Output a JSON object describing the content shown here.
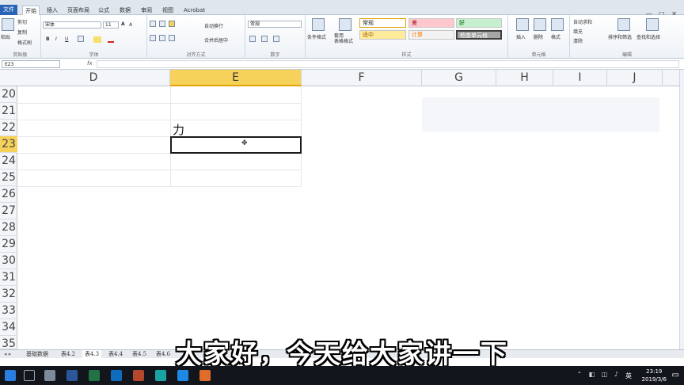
{
  "ribbon_tabs": [
    "文件",
    "开始",
    "插入",
    "页面布局",
    "公式",
    "数据",
    "审阅",
    "视图",
    "Acrobat"
  ],
  "window_controls": "— □ ✕",
  "clipboard": {
    "paste": "粘贴",
    "cut": "剪切",
    "copy": "复制",
    "painter": "格式刷",
    "label": "剪贴板"
  },
  "font": {
    "name": "宋体",
    "size": "11",
    "bold": "B",
    "italic": "I",
    "underline": "U",
    "grow": "A",
    "shrink": "A",
    "label": "字体"
  },
  "alignment": {
    "wrap": "自动换行",
    "merge": "合并后居中",
    "label": "对齐方式"
  },
  "number": {
    "format": "常规",
    "label": "数字"
  },
  "styles": {
    "conditional": "条件格式",
    "table": "套用\n表格格式",
    "normal": "常规",
    "bad": "差",
    "good": "好",
    "neutral": "适中",
    "calc": "计算",
    "check": "检查单元格",
    "label": "样式"
  },
  "cells_grp": {
    "insert": "插入",
    "delete": "删除",
    "format": "格式",
    "label": "单元格"
  },
  "editing": {
    "autosum": "自动求和",
    "fill": "填充",
    "clear": "清除",
    "sort": "排序和筛选",
    "find": "查找和选择",
    "label": "编辑"
  },
  "name_box": "E23",
  "fx": "fx",
  "columns": [
    "D",
    "E",
    "F",
    "G",
    "H",
    "I",
    "J"
  ],
  "rows": [
    "20",
    "21",
    "22",
    "23",
    "24",
    "25",
    "26",
    "27",
    "28",
    "29",
    "30",
    "31",
    "32",
    "33",
    "34",
    "35"
  ],
  "cell_e22": "力",
  "sheet_tabs": [
    "基础数据",
    "表4.2",
    "表4.3",
    "表4.4",
    "表4.5",
    "表4.6"
  ],
  "subtitle": "大家好，今天给大家讲一下",
  "taskbar": {
    "time": "23:19",
    "date": "2019/3/6",
    "lang": "英"
  },
  "colors": {
    "accent": "#2a64b4",
    "selected_header": "#f7d25a",
    "taskbar": "#12161c",
    "style_bad": "#ffc7ce",
    "style_good": "#c6efce",
    "style_neutral": "#ffeb9c",
    "style_check": "#a5a5a5"
  }
}
